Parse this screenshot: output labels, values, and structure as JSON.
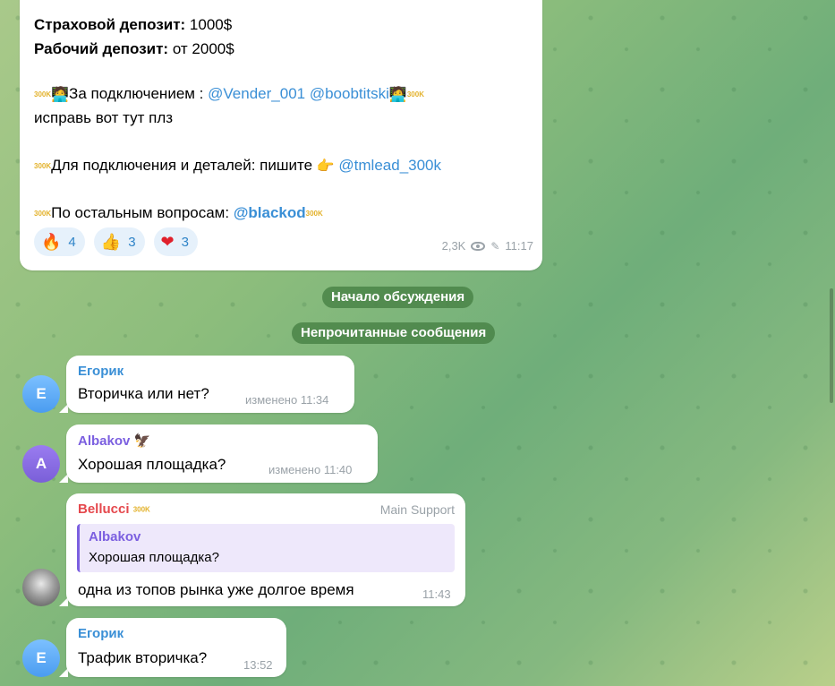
{
  "post": {
    "insurance_label": "Страховой депозит:",
    "insurance_value": " 1000$",
    "working_label": "Рабочий депозит:",
    "working_value": " от 2000$",
    "badge": "300K",
    "connect_text": "За подключением : ",
    "mention1": "@Vender_001",
    "mention2": "@boobtitski",
    "fix_text": "исправь вот тут плз",
    "details_text": "Для подключения и деталей: пишите ",
    "mention3": "@tmlead_300k",
    "other_text": "По остальным вопросам: ",
    "mention4": "@blackod",
    "reactions": [
      {
        "icon": "fire-icon",
        "emoji": "🔥",
        "count": "4"
      },
      {
        "icon": "thumbs-up-icon",
        "emoji": "👍",
        "count": "3"
      },
      {
        "icon": "heart-icon",
        "emoji": "❤",
        "count": "3"
      }
    ],
    "views": "2,3K",
    "time": "11:17"
  },
  "service": {
    "discussion_start": "Начало обсуждения",
    "unread": "Непрочитанные сообщения"
  },
  "messages": [
    {
      "sender": "Егорик",
      "avatar": "Е",
      "text": "Вторичка или нет?",
      "time": "изменено 11:34",
      "color": "#3a8fd6"
    },
    {
      "sender": "Albakov",
      "avatar": "A",
      "emoji": "🦅",
      "text": "Хорошая  площадка?",
      "time": "изменено 11:40",
      "color": "#7b5fe0"
    },
    {
      "sender": "Bellucci",
      "badge": "300K",
      "role": "Main Support",
      "reply_name": "Albakov",
      "reply_text": "Хорошая площадка?",
      "text": "одна из топов рынка уже долгое время",
      "time": "11:43",
      "color": "#e5484d"
    },
    {
      "sender": "Егорик",
      "avatar": "Е",
      "text": "Трафик вторичка?",
      "time": "13:52",
      "color": "#3a8fd6"
    }
  ],
  "colors": {
    "mention": "#3a8fd6",
    "service_bg": "#4a8448",
    "reaction_bg": "#e6f1fb"
  }
}
